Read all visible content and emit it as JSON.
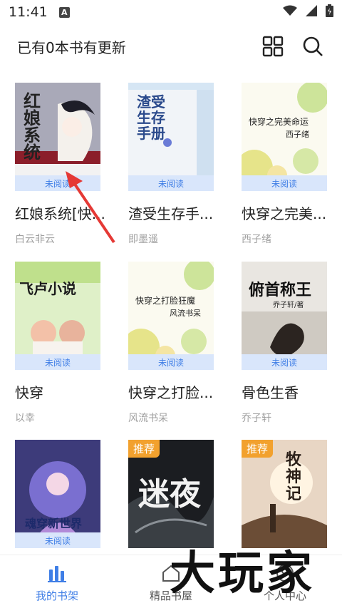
{
  "status_bar": {
    "time": "11:41",
    "notification_glyph": "A",
    "icons": [
      "wifi-icon",
      "signal-icon",
      "battery-icon"
    ]
  },
  "header": {
    "update_text": "已有0本书有更新",
    "icons": [
      "grid-icon",
      "search-icon"
    ]
  },
  "books": [
    {
      "title": "红娘系统[快...",
      "author": "白云非云",
      "status": "未阅读",
      "cover_text": "红娘系统",
      "badge": ""
    },
    {
      "title": "渣受生存手...",
      "author": "即墨遥",
      "status": "未阅读",
      "cover_text": "渣受生存手册",
      "badge": ""
    },
    {
      "title": "快穿之完美...",
      "author": "西子绪",
      "status": "未阅读",
      "cover_text": "快穿之完美命运",
      "cover_author": "西子绪",
      "badge": ""
    },
    {
      "title": "快穿",
      "author": "以幸",
      "status": "未阅读",
      "cover_text": "飞卢小说",
      "badge": ""
    },
    {
      "title": "快穿之打脸...",
      "author": "风流书呆",
      "status": "未阅读",
      "cover_text": "快穿之打脸狂魔",
      "cover_author": "风流书呆",
      "badge": ""
    },
    {
      "title": "骨色生香",
      "author": "乔子轩",
      "status": "未阅读",
      "cover_text": "俯首称王",
      "cover_author": "乔子轩/著",
      "badge": ""
    },
    {
      "title": "",
      "author": "",
      "status": "未阅读",
      "cover_text": "魂穿新世界",
      "badge": ""
    },
    {
      "title": "",
      "author": "",
      "status": "",
      "cover_text": "迷夜",
      "badge": "推荐"
    },
    {
      "title": "",
      "author": "",
      "status": "",
      "cover_text": "牧神记",
      "badge": "推荐"
    }
  ],
  "tabs": [
    {
      "label": "我的书架",
      "active": true,
      "icon": "bookshelf-icon"
    },
    {
      "label": "精品书屋",
      "active": false,
      "icon": "home-icon"
    },
    {
      "label": "个人中心",
      "active": false,
      "icon": "person-icon"
    }
  ],
  "watermark": "大玩家",
  "colors": {
    "accent": "#3f7ee6",
    "strip": "#d9e6fb",
    "badge": "#f2a12e",
    "arrow": "#e53935"
  }
}
